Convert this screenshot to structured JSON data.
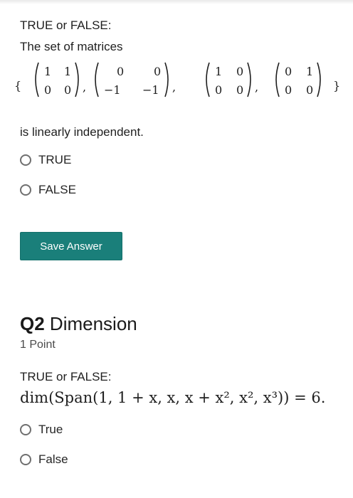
{
  "q1": {
    "prompt": "TRUE or FALSE:",
    "statement_intro": "The set of matrices",
    "matrices": [
      [
        [
          "1",
          "1"
        ],
        [
          "0",
          "0"
        ]
      ],
      [
        [
          "0",
          "0"
        ],
        [
          "−1",
          "−1"
        ]
      ],
      [
        [
          "1",
          "0"
        ],
        [
          "0",
          "0"
        ]
      ],
      [
        [
          "0",
          "1"
        ],
        [
          "0",
          "0"
        ]
      ]
    ],
    "statement_end": "is linearly independent.",
    "options": [
      "TRUE",
      "FALSE"
    ],
    "save_label": "Save Answer"
  },
  "q2": {
    "number": "Q2",
    "title": "Dimension",
    "points": "1 Point",
    "prompt": "TRUE or FALSE:",
    "formula_text": "dim(Span(1, 1 + x, x, x + x², x², x³)) = 6.",
    "options": [
      "True",
      "False"
    ]
  },
  "colors": {
    "accent": "#1a7f7a",
    "radio_border": "#6f6f6f"
  }
}
